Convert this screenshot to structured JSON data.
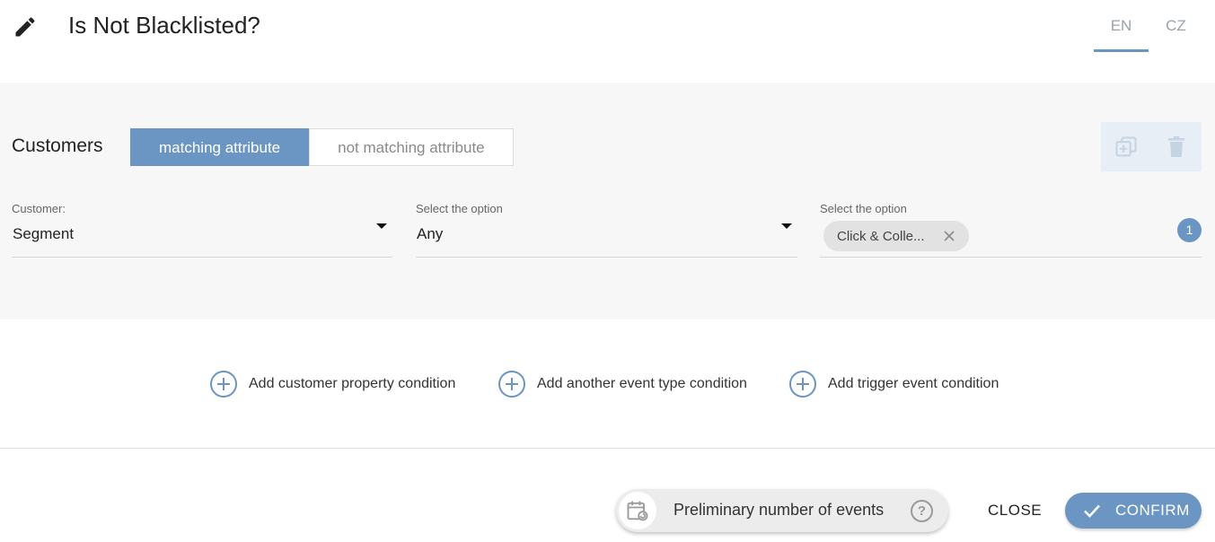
{
  "header": {
    "title": "Is Not Blacklisted?",
    "languages": [
      {
        "label": "EN",
        "active": true
      },
      {
        "label": "CZ",
        "active": false
      }
    ]
  },
  "condition": {
    "entity_label": "Customers",
    "toggle": {
      "matching_label": "matching attribute",
      "not_matching_label": "not matching attribute",
      "selected": "matching attribute"
    },
    "fields": {
      "customer": {
        "label": "Customer:",
        "value": "Segment"
      },
      "option1": {
        "label": "Select the option",
        "value": "Any"
      },
      "option2": {
        "label": "Select the option",
        "chip": "Click & Colle...",
        "count": "1"
      }
    },
    "icons": {
      "duplicate": "duplicate-icon",
      "delete": "trash-icon"
    }
  },
  "add_conditions": {
    "customer_property": "Add customer property condition",
    "event_type": "Add another event type condition",
    "trigger_event": "Add trigger event condition"
  },
  "footer": {
    "preliminary_label": "Preliminary number of events",
    "help_glyph": "?",
    "close_label": "CLOSE",
    "confirm_label": "CONFIRM"
  },
  "colors": {
    "accent": "#6b95c2",
    "panel_bg": "#f7f7f7",
    "actions_bg": "#e8eef5"
  }
}
